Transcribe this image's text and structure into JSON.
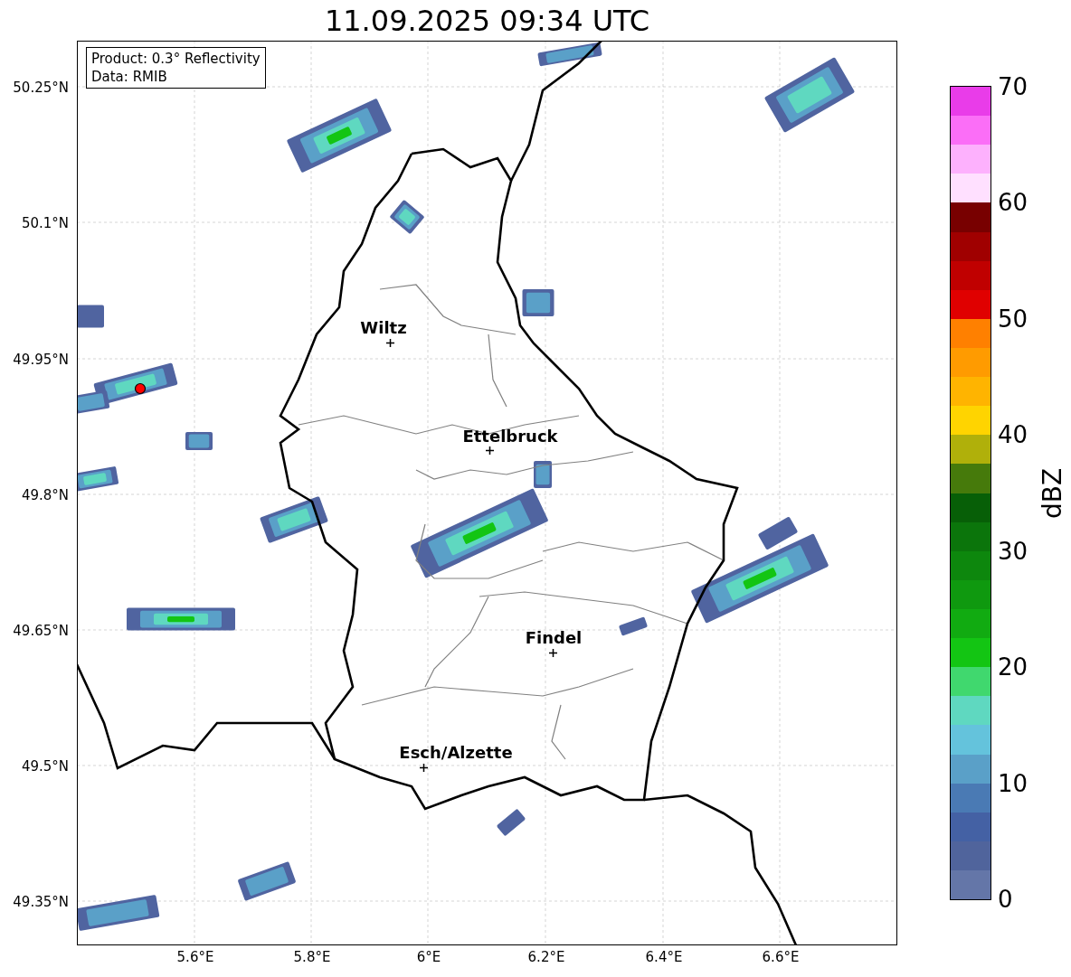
{
  "title": "11.09.2025 09:34 UTC",
  "info": {
    "lines": [
      "Product: 0.3° Reflectivity",
      "Data: RMIB"
    ]
  },
  "cities": [
    {
      "name": "Wiltz"
    },
    {
      "name": "Ettelbruck"
    },
    {
      "name": "Findel"
    },
    {
      "name": "Esch/Alzette"
    }
  ],
  "lat_ticks": [
    "50.25°N",
    "50.1°N",
    "49.95°N",
    "49.8°N",
    "49.65°N",
    "49.5°N",
    "49.35°N"
  ],
  "lon_ticks": [
    "5.6°E",
    "5.8°E",
    "6°E",
    "6.2°E",
    "6.4°E",
    "6.6°E"
  ],
  "colorbar": {
    "label": "dBZ",
    "ticks": [
      "70",
      "60",
      "50",
      "40",
      "30",
      "20",
      "10",
      "0"
    ],
    "steps": [
      {
        "color": "#e93ce9"
      },
      {
        "color": "#fb6ef7"
      },
      {
        "color": "#fdb1fd"
      },
      {
        "color": "#ffe0ff"
      },
      {
        "color": "#780000"
      },
      {
        "color": "#a00000"
      },
      {
        "color": "#c00000"
      },
      {
        "color": "#e00000"
      },
      {
        "color": "#ff8000"
      },
      {
        "color": "#ff9b00"
      },
      {
        "color": "#ffb400"
      },
      {
        "color": "#ffd400"
      },
      {
        "color": "#b0b00a"
      },
      {
        "color": "#467a0b"
      },
      {
        "color": "#075f07"
      },
      {
        "color": "#0b750b"
      },
      {
        "color": "#0d870d"
      },
      {
        "color": "#0f990f"
      },
      {
        "color": "#11ab11"
      },
      {
        "color": "#13c513"
      },
      {
        "color": "#40d86e"
      },
      {
        "color": "#5fd8c0"
      },
      {
        "color": "#64c3dc"
      },
      {
        "color": "#5aa0c8"
      },
      {
        "color": "#4a7ab4"
      },
      {
        "color": "#4461a4"
      },
      {
        "color": "#50649c"
      },
      {
        "color": "#6476a8"
      }
    ]
  }
}
